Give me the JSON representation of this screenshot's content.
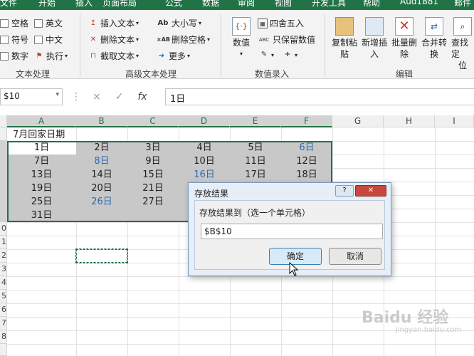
{
  "ribbon_tabs": [
    "文件",
    "开始",
    "插入",
    "页面布局",
    "公式",
    "数据",
    "审阅",
    "视图",
    "开发工具",
    "帮助",
    "Aud1881",
    "邮件"
  ],
  "groups": {
    "text_process": {
      "label": "文本处理",
      "items": [
        "空格",
        "英文",
        "符号",
        "中文",
        "数字",
        "执行"
      ]
    },
    "advanced_text": {
      "label": "高级文本处理",
      "items": [
        "插入文本",
        "删除文本",
        "截取文本",
        "大小写",
        "删除空格",
        "更多"
      ]
    },
    "numeric_entry": {
      "label": "数值录入",
      "big_label": "数值",
      "items": [
        "四舍五入",
        "只保留数值"
      ]
    },
    "edit": {
      "label": "编辑",
      "buttons": [
        {
          "line1": "复制粘",
          "line2": "贴"
        },
        {
          "line1": "新增插",
          "line2": "入"
        },
        {
          "line1": "批量删",
          "line2": "除"
        },
        {
          "line1": "合并转",
          "line2": "换"
        },
        {
          "line1": "查找定",
          "line2": "位"
        }
      ]
    }
  },
  "formula_bar": {
    "name_box": "$10",
    "cancel": "×",
    "confirm": "✓",
    "fx": "fx",
    "formula": "1日"
  },
  "columns": [
    "A",
    "B",
    "C",
    "D",
    "E",
    "F",
    "G",
    "H",
    "I"
  ],
  "rows": [
    "",
    "",
    "",
    "",
    "",
    "",
    "",
    "0",
    "1",
    "2",
    "3",
    "4",
    "5",
    "6",
    "7",
    "8",
    ""
  ],
  "sheet": {
    "title": "7月回家日期",
    "days": [
      [
        "1日",
        "2日",
        "3日",
        "4日",
        "5日",
        "6日"
      ],
      [
        "7日",
        "8日",
        "9日",
        "10日",
        "11日",
        "12日"
      ],
      [
        "13日",
        "14日",
        "15日",
        "16日",
        "17日",
        "18日"
      ],
      [
        "19日",
        "20日",
        "21日",
        "22日",
        "23日",
        "24日"
      ],
      [
        "25日",
        "26日",
        "27日",
        "28日",
        "29日",
        "30日"
      ],
      [
        "31日",
        "",
        "",
        "",
        "",
        ""
      ]
    ],
    "blue_days": [
      "6日",
      "8日",
      "16日",
      "26日"
    ]
  },
  "dialog": {
    "title": "存放结果",
    "help": "?",
    "close": "✕",
    "prompt": "存放结果到（选一个单元格）",
    "value": "$B$10",
    "ok": "确定",
    "cancel": "取消"
  },
  "watermark": {
    "text": "Baidu 经验",
    "sub": "jingyan.baidu.com"
  }
}
